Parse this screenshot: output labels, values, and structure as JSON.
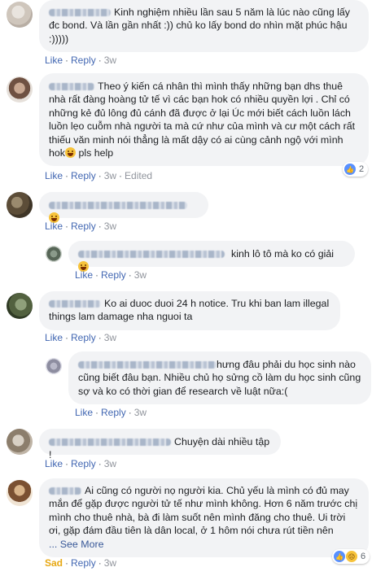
{
  "actions": {
    "like": "Like",
    "reply": "Reply",
    "sep": "·",
    "see_more": "... See More"
  },
  "comments": [
    {
      "text": "Kinh nghiệm nhiều lần sau 5 năm là lúc nào cũng lấy đc bond. Và lần gần nhất :)) chủ ko lấy bond do nhìn mặt phúc hậu :)))))",
      "time": "3w"
    },
    {
      "text": "Theo ý kiến cá nhân thì mình thấy những bạn dhs thuê nhà rất đàng hoàng tử tế vì các bạn hok có nhiều quyền lợi . Chỉ có những kẻ đủ lông đủ cánh đã được ở lại Úc mới biết cách luồn lách luồn lẹo cuỗm nhà người ta mà cứ như của mình và cư một cách rất thiếu văn minh nói thẳng là mất dậy có ai cùng cảnh ngộ với mình hok",
      "text_after": "pls help",
      "time": "3w",
      "edited": "Edited",
      "reaction_count": "2"
    },
    {
      "text": "",
      "time": "3w"
    },
    {
      "text": "kinh lô tô mà ko có giải",
      "time": "3w"
    },
    {
      "text": "Ko ai duoc duoi 24 h notice. Tru khi ban lam illegal things lam damage nha nguoi ta",
      "time": "3w"
    },
    {
      "text": "hưng đâu phải du học sinh nào cũng biết đâu bạn. Nhiều chủ họ sửng cồ làm du học sinh cũng sợ và ko có thời gian để research về luật nữa:(",
      "time": "3w"
    },
    {
      "text": "Chuyện dài nhiều tập !",
      "time": "3w"
    },
    {
      "text": "Ai cũng có người nọ người kia. Chủ yếu là mình có đủ may mắn để gặp được người tử tế như mình không. Hơn 6 năm trước chị mình cho thuê nhà, bà đi làm suốt nên mình đăng cho thuê. Ui trời ơi, gặp đám đầu tiên là dân local, ở 1 hôm nói chưa rút tiền nên",
      "time": "3w",
      "reaction_label": "Sad",
      "reaction_count": "6"
    }
  ]
}
